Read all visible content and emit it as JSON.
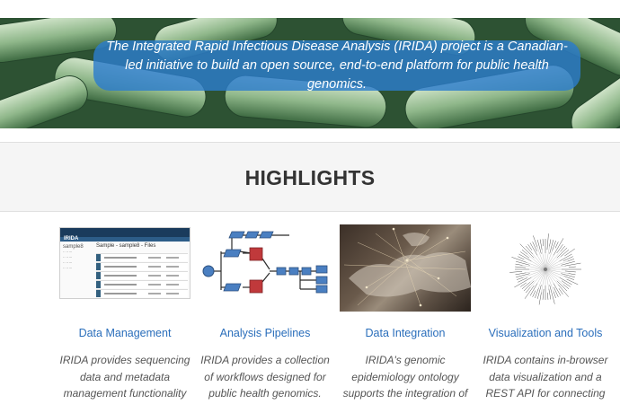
{
  "hero": {
    "text": "The Integrated Rapid Infectious Disease Analysis (IRIDA) project is a Canadian-led initiative to build an open source, end-to-end platform for public health genomics."
  },
  "highlights": {
    "heading": "HIGHLIGHTS"
  },
  "cards": [
    {
      "title": "Data Management",
      "description": "IRIDA provides sequencing data and metadata management functionality",
      "thumb": {
        "brand": "IRIDA",
        "page_title": "Sample - sample8 - Files",
        "side_label": "sample8"
      }
    },
    {
      "title": "Analysis Pipelines",
      "description": "IRIDA provides a collection of workflows designed for public health genomics."
    },
    {
      "title": "Data Integration",
      "description": "IRIDA's genomic epidemiology ontology supports the integration of"
    },
    {
      "title": "Visualization and Tools",
      "description": "IRIDA contains in-browser data visualization and a REST API for connecting"
    }
  ],
  "colors": {
    "banner": "#2c7dcc",
    "link": "#2a6ebb",
    "band": "#f5f5f5"
  }
}
